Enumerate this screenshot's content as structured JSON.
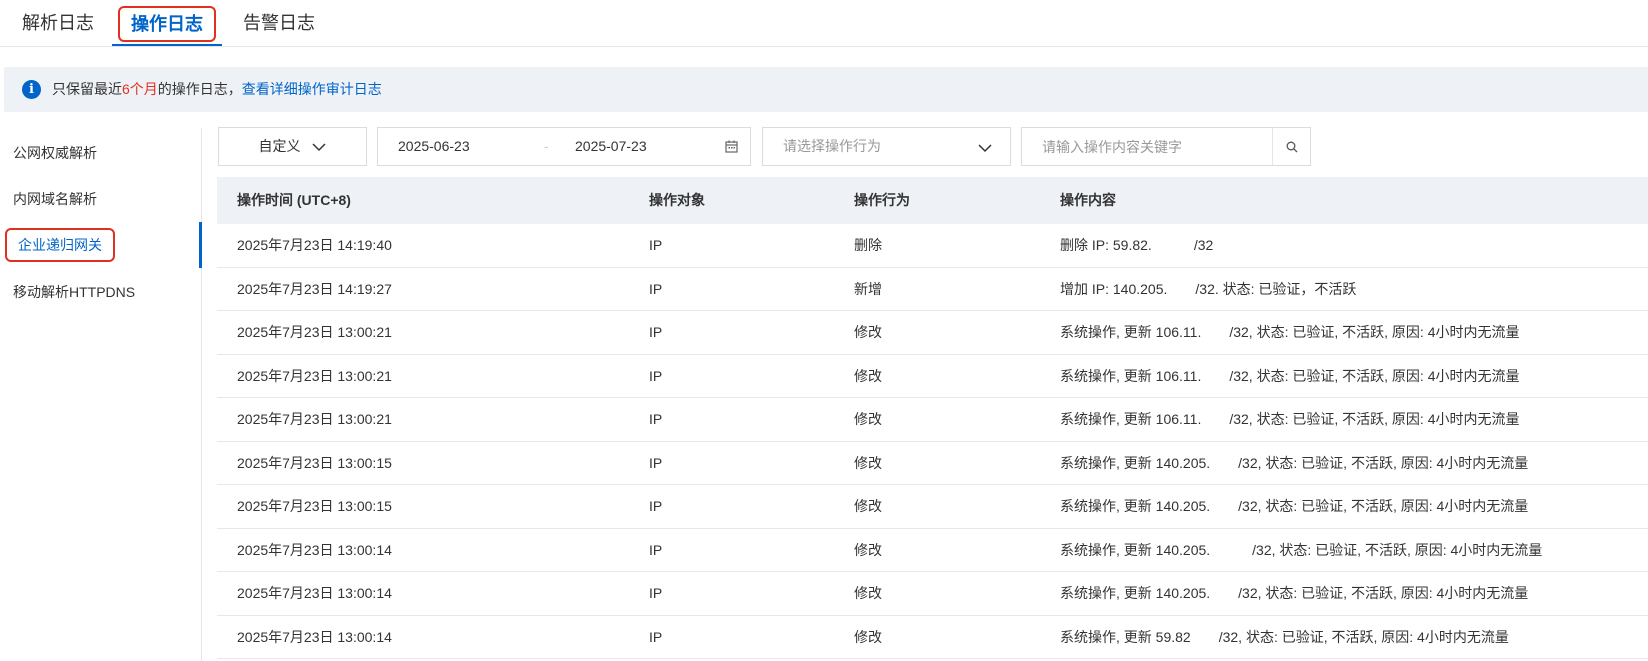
{
  "tabs": [
    {
      "label": "解析日志"
    },
    {
      "label": "操作日志"
    },
    {
      "label": "告警日志"
    }
  ],
  "notice": {
    "prefix": "只保留最近",
    "highlight": "6个月",
    "suffix": "的操作日志，",
    "link": "查看详细操作审计日志"
  },
  "sidebar": {
    "items": [
      {
        "label": "公网权威解析"
      },
      {
        "label": "内网域名解析"
      },
      {
        "label": "企业递归网关"
      },
      {
        "label": "移动解析HTTPDNS"
      }
    ]
  },
  "filters": {
    "time_range": "自定义",
    "start_date": "2025-06-23",
    "end_date": "2025-07-23",
    "date_separator": "-",
    "action_placeholder": "请选择操作行为",
    "search_placeholder": "请输入操作内容关键字"
  },
  "table": {
    "headers": [
      "操作时间 (UTC+8)",
      "操作对象",
      "操作行为",
      "操作内容"
    ],
    "rows": [
      {
        "time": "2025年7月23日 14:19:40",
        "object": "IP",
        "action": "删除",
        "content": "删除 IP: 59.82.　　　/32"
      },
      {
        "time": "2025年7月23日 14:19:27",
        "object": "IP",
        "action": "新增",
        "content": "增加 IP: 140.205.　　/32. 状态: 已验证，不活跃"
      },
      {
        "time": "2025年7月23日 13:00:21",
        "object": "IP",
        "action": "修改",
        "content": "系统操作, 更新 106.11.　　/32, 状态: 已验证, 不活跃, 原因: 4小时内无流量"
      },
      {
        "time": "2025年7月23日 13:00:21",
        "object": "IP",
        "action": "修改",
        "content": "系统操作, 更新 106.11.　　/32, 状态: 已验证, 不活跃, 原因: 4小时内无流量"
      },
      {
        "time": "2025年7月23日 13:00:21",
        "object": "IP",
        "action": "修改",
        "content": "系统操作, 更新 106.11.　　/32, 状态: 已验证, 不活跃, 原因: 4小时内无流量"
      },
      {
        "time": "2025年7月23日 13:00:15",
        "object": "IP",
        "action": "修改",
        "content": "系统操作, 更新 140.205.　　/32, 状态: 已验证, 不活跃, 原因: 4小时内无流量"
      },
      {
        "time": "2025年7月23日 13:00:15",
        "object": "IP",
        "action": "修改",
        "content": "系统操作, 更新 140.205.　　/32, 状态: 已验证, 不活跃, 原因: 4小时内无流量"
      },
      {
        "time": "2025年7月23日 13:00:14",
        "object": "IP",
        "action": "修改",
        "content": "系统操作, 更新 140.205.　　　/32, 状态: 已验证, 不活跃, 原因: 4小时内无流量"
      },
      {
        "time": "2025年7月23日 13:00:14",
        "object": "IP",
        "action": "修改",
        "content": "系统操作, 更新 140.205.　　/32, 状态: 已验证, 不活跃, 原因: 4小时内无流量"
      },
      {
        "time": "2025年7月23日 13:00:14",
        "object": "IP",
        "action": "修改",
        "content": "系统操作, 更新 59.82　　/32, 状态: 已验证, 不活跃, 原因: 4小时内无流量"
      }
    ]
  },
  "colors": {
    "accent": "#0064c8",
    "highlight_red": "#e0301e",
    "header_bg": "#eef2f7"
  }
}
